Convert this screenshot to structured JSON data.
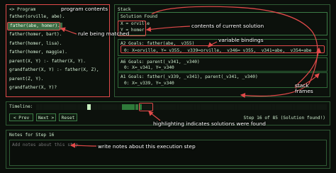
{
  "program": {
    "title": "<> Program",
    "lines": [
      "father(orville, abe).",
      "father(abe, homer).",
      "father(homer, bart).",
      "father(homer, lisa).",
      "father(homer, maggie).",
      "parent(X, Y) :- father(X, Y).",
      "grandfather(X, Y) :- father(X, Z),",
      "  parent(Z, Y).",
      "grandfather(X, Y)?"
    ],
    "selected_index": 1
  },
  "stack": {
    "title": "Stack",
    "solution": {
      "heading": "Solution Found",
      "lines": [
        "X = orville",
        "Y = homer"
      ]
    },
    "frames": [
      {
        "goals": "A2 Goals: father(abe, _v355)",
        "binding": "0: X=orville, Y=_v355, _v339=orville, _v346=_v355, _v341=abe, _v354=abe"
      },
      {
        "goals": "A6 Goals: parent(_v341, _v340)",
        "binding": "0: X=_v341, Y=_v340"
      },
      {
        "goals": "A1 Goals: father(_v339, _v341), parent(_v341, _v340)",
        "binding": "0: X=_v339, Y=_v340"
      }
    ]
  },
  "timeline": {
    "label": "Timeline:",
    "prev": "< Prev",
    "next": "Next >",
    "reset": "Reset",
    "status": "Step 16 of 85 (Solution found!)",
    "total_steps": 85,
    "current_step": 16,
    "solution_steps": [
      16,
      26,
      27,
      28,
      29,
      30,
      31
    ]
  },
  "notes": {
    "title": "Notes for Step 16",
    "placeholder": "Add notes about this step..."
  },
  "annotations": {
    "program_contents": "program contents",
    "rule_matched": "rule being matched",
    "current_solution": "contents of current solution",
    "variable_bindings": "variable bindings",
    "stack_frames": "stack\nframes",
    "solutions_found": "highlighting indicates solutions were found",
    "write_notes": "write notes about this execution step"
  },
  "colors": {
    "accent": "#a6e3a1",
    "annotation": "#e24a4a",
    "solution_cell": "#2f7a3a"
  }
}
